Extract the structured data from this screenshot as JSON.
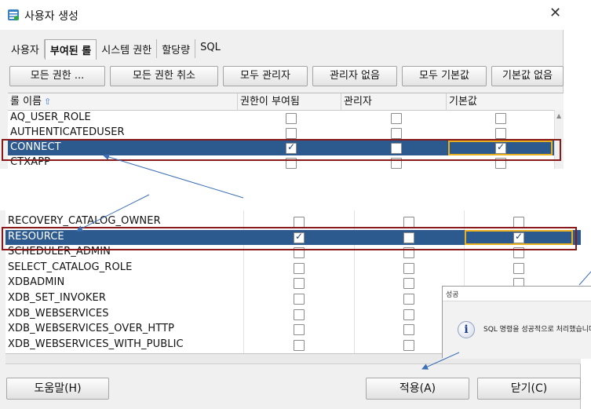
{
  "window": {
    "title": "사용자 생성",
    "close_glyph": "✕"
  },
  "tabs": [
    {
      "label": "사용자",
      "active": false
    },
    {
      "label": "부여된 롤",
      "active": true
    },
    {
      "label": "시스템 권한",
      "active": false
    },
    {
      "label": "할당량",
      "active": false
    },
    {
      "label": "SQL",
      "active": false
    }
  ],
  "toolbar": {
    "grant_all": "모든 권한 ...",
    "revoke_all": "모든 권한 취소",
    "admin_all": "모두 관리자",
    "no_admin": "관리자 없음",
    "default_all": "모두 기본값",
    "default_none": "기본값 없음"
  },
  "grid": {
    "headers": {
      "role": "롤 이름",
      "granted": "권한이 부여됨",
      "admin": "관리자",
      "default": "기본값"
    },
    "sort_icon": "sort-ascending-icon",
    "top_rows": [
      {
        "name": "AQ_USER_ROLE",
        "granted": false,
        "admin": false,
        "default": false,
        "selected": false
      },
      {
        "name": "AUTHENTICATEDUSER",
        "granted": false,
        "admin": false,
        "default": false,
        "selected": false
      },
      {
        "name": "CONNECT",
        "granted": true,
        "admin": false,
        "default": true,
        "selected": true
      },
      {
        "name": "CTXAPP",
        "granted": false,
        "admin": false,
        "default": false,
        "selected": false
      }
    ],
    "bottom_rows": [
      {
        "name": "RECOVERY_CATALOG_OWNER",
        "granted": false,
        "admin": false,
        "default": false,
        "selected": false
      },
      {
        "name": "RESOURCE",
        "granted": true,
        "admin": false,
        "default": true,
        "selected": true
      },
      {
        "name": "SCHEDULER_ADMIN",
        "granted": false,
        "admin": false,
        "default": false,
        "selected": false
      },
      {
        "name": "SELECT_CATALOG_ROLE",
        "granted": false,
        "admin": false,
        "default": false,
        "selected": false
      },
      {
        "name": "XDBADMIN",
        "granted": false,
        "admin": false,
        "default": false,
        "selected": false
      },
      {
        "name": "XDB_SET_INVOKER",
        "granted": false,
        "admin": false,
        "default": false,
        "selected": false
      },
      {
        "name": "XDB_WEBSERVICES",
        "granted": false,
        "admin": false,
        "default": false,
        "selected": false
      },
      {
        "name": "XDB_WEBSERVICES_OVER_HTTP",
        "granted": false,
        "admin": false,
        "default": false,
        "selected": false
      },
      {
        "name": "XDB_WEBSERVICES_WITH_PUBLIC",
        "granted": false,
        "admin": false,
        "default": false,
        "selected": false
      }
    ]
  },
  "footer": {
    "help": "도움말(H)",
    "apply": "적용(A)",
    "close": "닫기(C)"
  },
  "popup": {
    "title": "성공",
    "message": "SQL 명령을 성공적으로 처리했습니다",
    "icon": "info-icon"
  },
  "colors": {
    "selection": "#2c5a8f",
    "highlight_box": "#8a1a1a",
    "cell_focus": "#e6b020",
    "arrow": "#3b6fb6"
  }
}
